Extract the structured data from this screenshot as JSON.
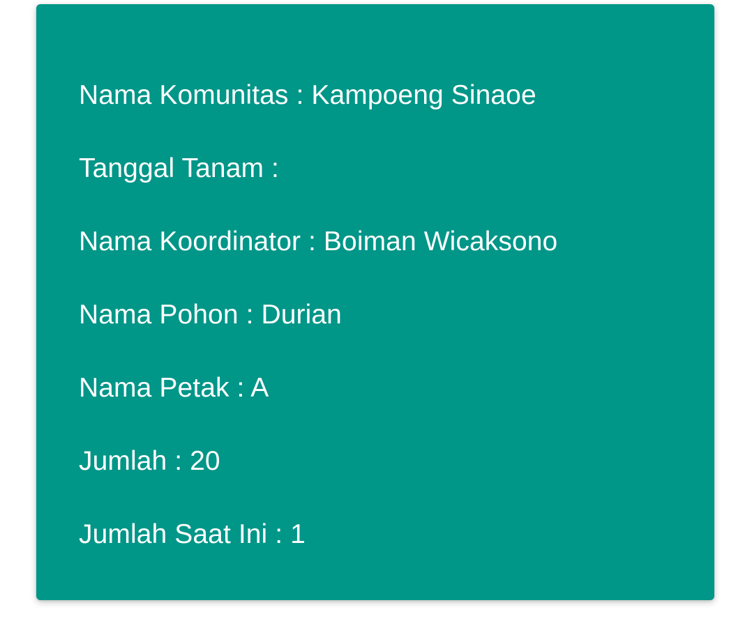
{
  "colors": {
    "card_background": "#009688",
    "text": "#ffffff",
    "page_background": "#ffffff"
  },
  "detail": {
    "rows": [
      {
        "label": "Nama Komunitas",
        "separator": " : ",
        "value": "Kampoeng Sinaoe"
      },
      {
        "label": "Tanggal Tanam",
        "separator": " : ",
        "value": ""
      },
      {
        "label": "Nama Koordinator",
        "separator": " : ",
        "value": "Boiman Wicaksono"
      },
      {
        "label": "Nama Pohon",
        "separator": " : ",
        "value": "Durian"
      },
      {
        "label": "Nama Petak",
        "separator": " : ",
        "value": "A"
      },
      {
        "label": "Jumlah",
        "separator": " : ",
        "value": "20"
      },
      {
        "label": "Jumlah Saat Ini",
        "separator": " : ",
        "value": "1"
      }
    ]
  }
}
